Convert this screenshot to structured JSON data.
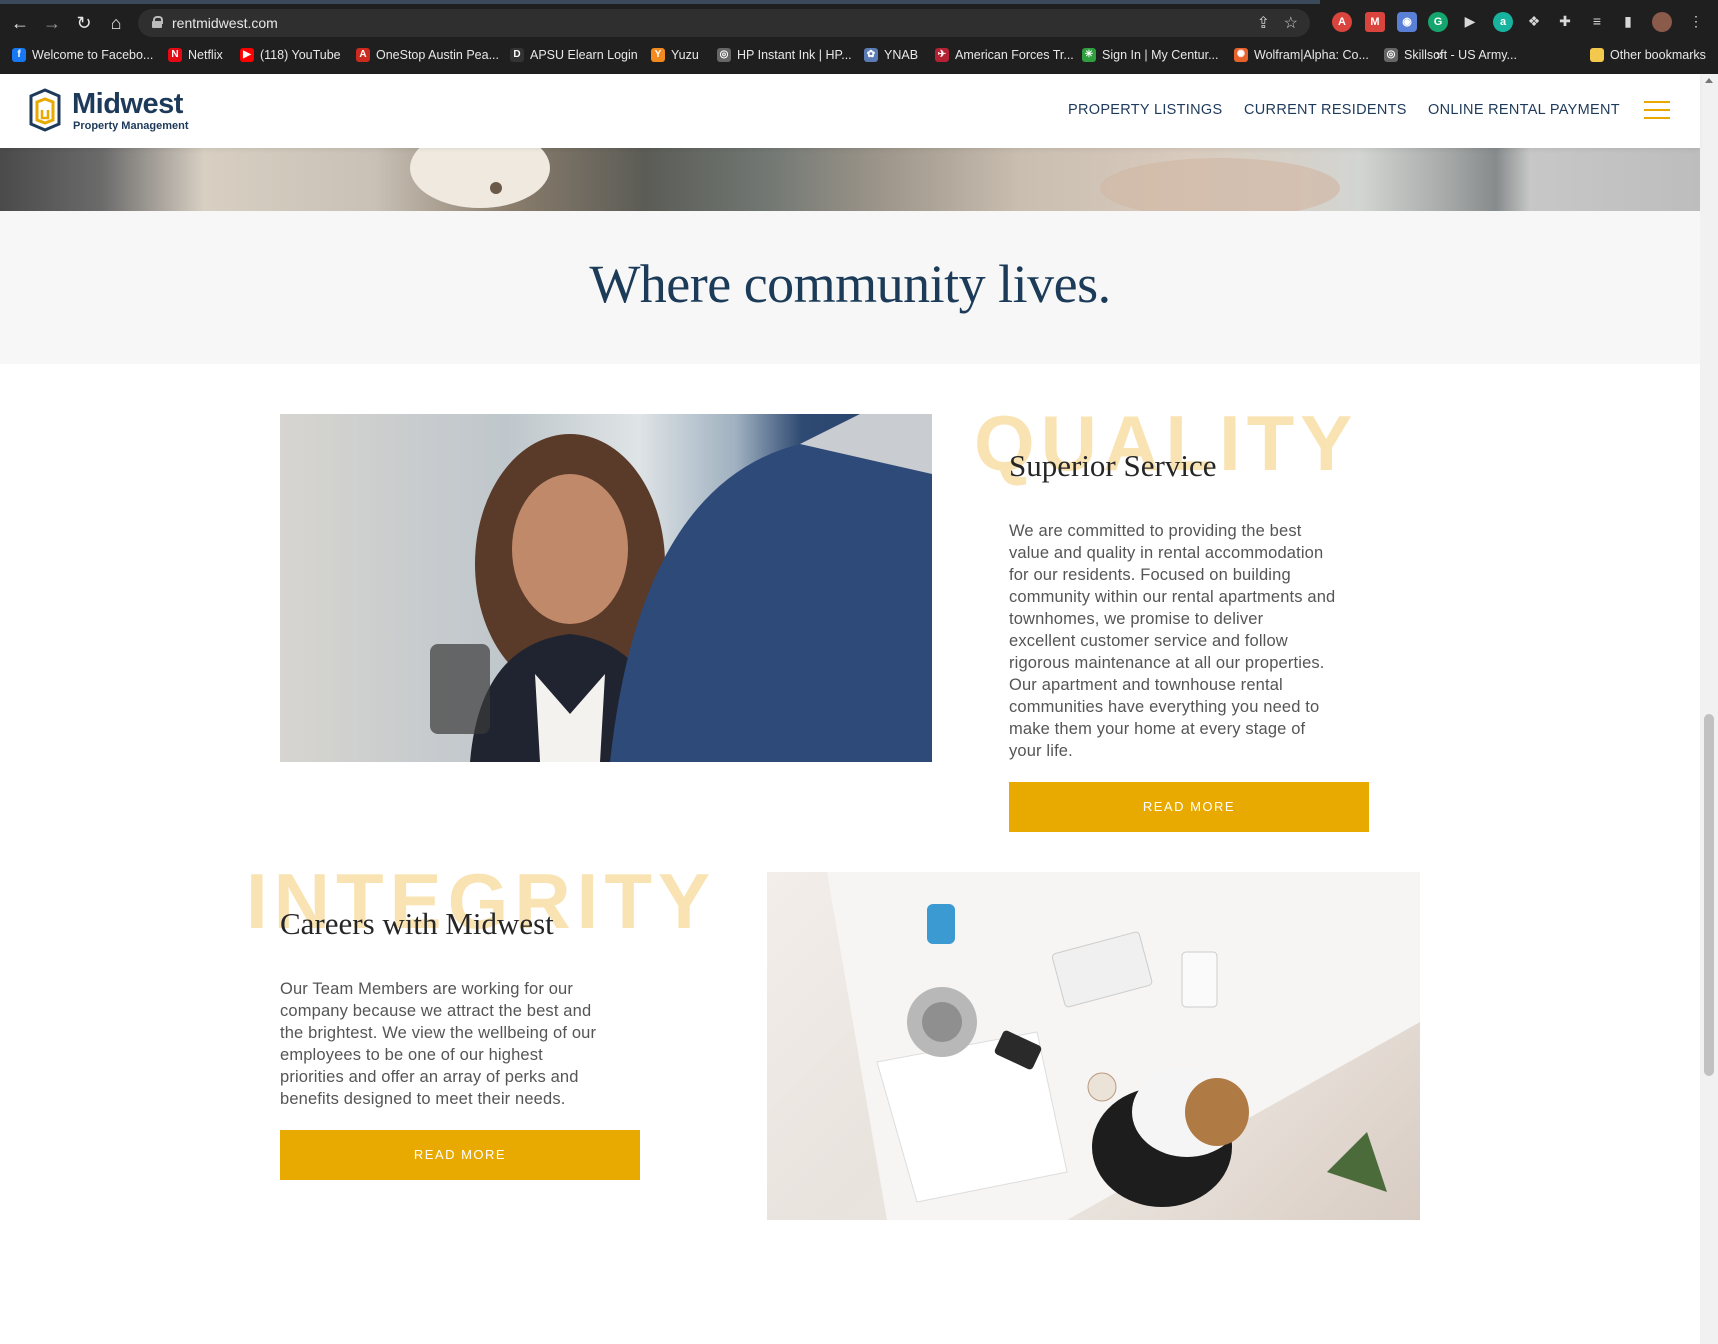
{
  "browser": {
    "url": "rentmidwest.com",
    "bookmarks": [
      {
        "label": "Welcome to Facebo...",
        "color": "#1877f2",
        "glyph": "f"
      },
      {
        "label": "Netflix",
        "color": "#e50914",
        "glyph": "N"
      },
      {
        "label": "(118) YouTube",
        "color": "#ff0000",
        "glyph": "▶"
      },
      {
        "label": "OneStop Austin Pea...",
        "color": "#cc2a1f",
        "glyph": "A"
      },
      {
        "label": "APSU Elearn Login",
        "color": "#333333",
        "glyph": "D"
      },
      {
        "label": "Yuzu",
        "color": "#f28a1e",
        "glyph": "Y"
      },
      {
        "label": "HP Instant Ink | HP...",
        "color": "#666666",
        "glyph": "◎"
      },
      {
        "label": "YNAB",
        "color": "#5b7bb5",
        "glyph": "✿"
      },
      {
        "label": "American Forces Tr...",
        "color": "#b22234",
        "glyph": "✈"
      },
      {
        "label": "Sign In | My Centur...",
        "color": "#2e9e3e",
        "glyph": "✳"
      },
      {
        "label": "Wolfram|Alpha: Co...",
        "color": "#e8622c",
        "glyph": "✺"
      },
      {
        "label": "Skillsoft - US Army...",
        "color": "#666666",
        "glyph": "◎"
      }
    ],
    "other_bookmarks": "Other bookmarks",
    "overflow": "»"
  },
  "site": {
    "logo_name": "Midwest",
    "logo_sub": "Property Management",
    "nav": [
      "PROPERTY LISTINGS",
      "CURRENT RESIDENTS",
      "ONLINE RENTAL PAYMENT"
    ],
    "accent_color": "#e8a900",
    "brand_color": "#1e3a5a"
  },
  "tagline": "Where community lives.",
  "quality": {
    "ghost_word": "QUALITY",
    "title": "Superior Service",
    "lines": [
      "We are committed to providing the best",
      "value and quality in rental accommodation",
      "for our residents. Focused on building",
      "community within our rental apartments and",
      "townhomes, we promise to deliver",
      "excellent customer service and follow",
      "rigorous maintenance at all our properties.",
      "Our apartment and townhouse rental",
      "communities have everything you need to",
      "make them your home at every stage of",
      "your life."
    ],
    "button": "READ MORE"
  },
  "integrity": {
    "ghost_word": "INTEGRITY",
    "title": "Careers with Midwest",
    "lines": [
      "Our Team Members are working for our",
      "company because we attract the best and",
      "the brightest. We view the wellbeing of our",
      "employees to be one of our highest",
      "priorities and offer an array of perks and",
      "benefits designed to meet their needs."
    ],
    "button": "READ MORE"
  }
}
